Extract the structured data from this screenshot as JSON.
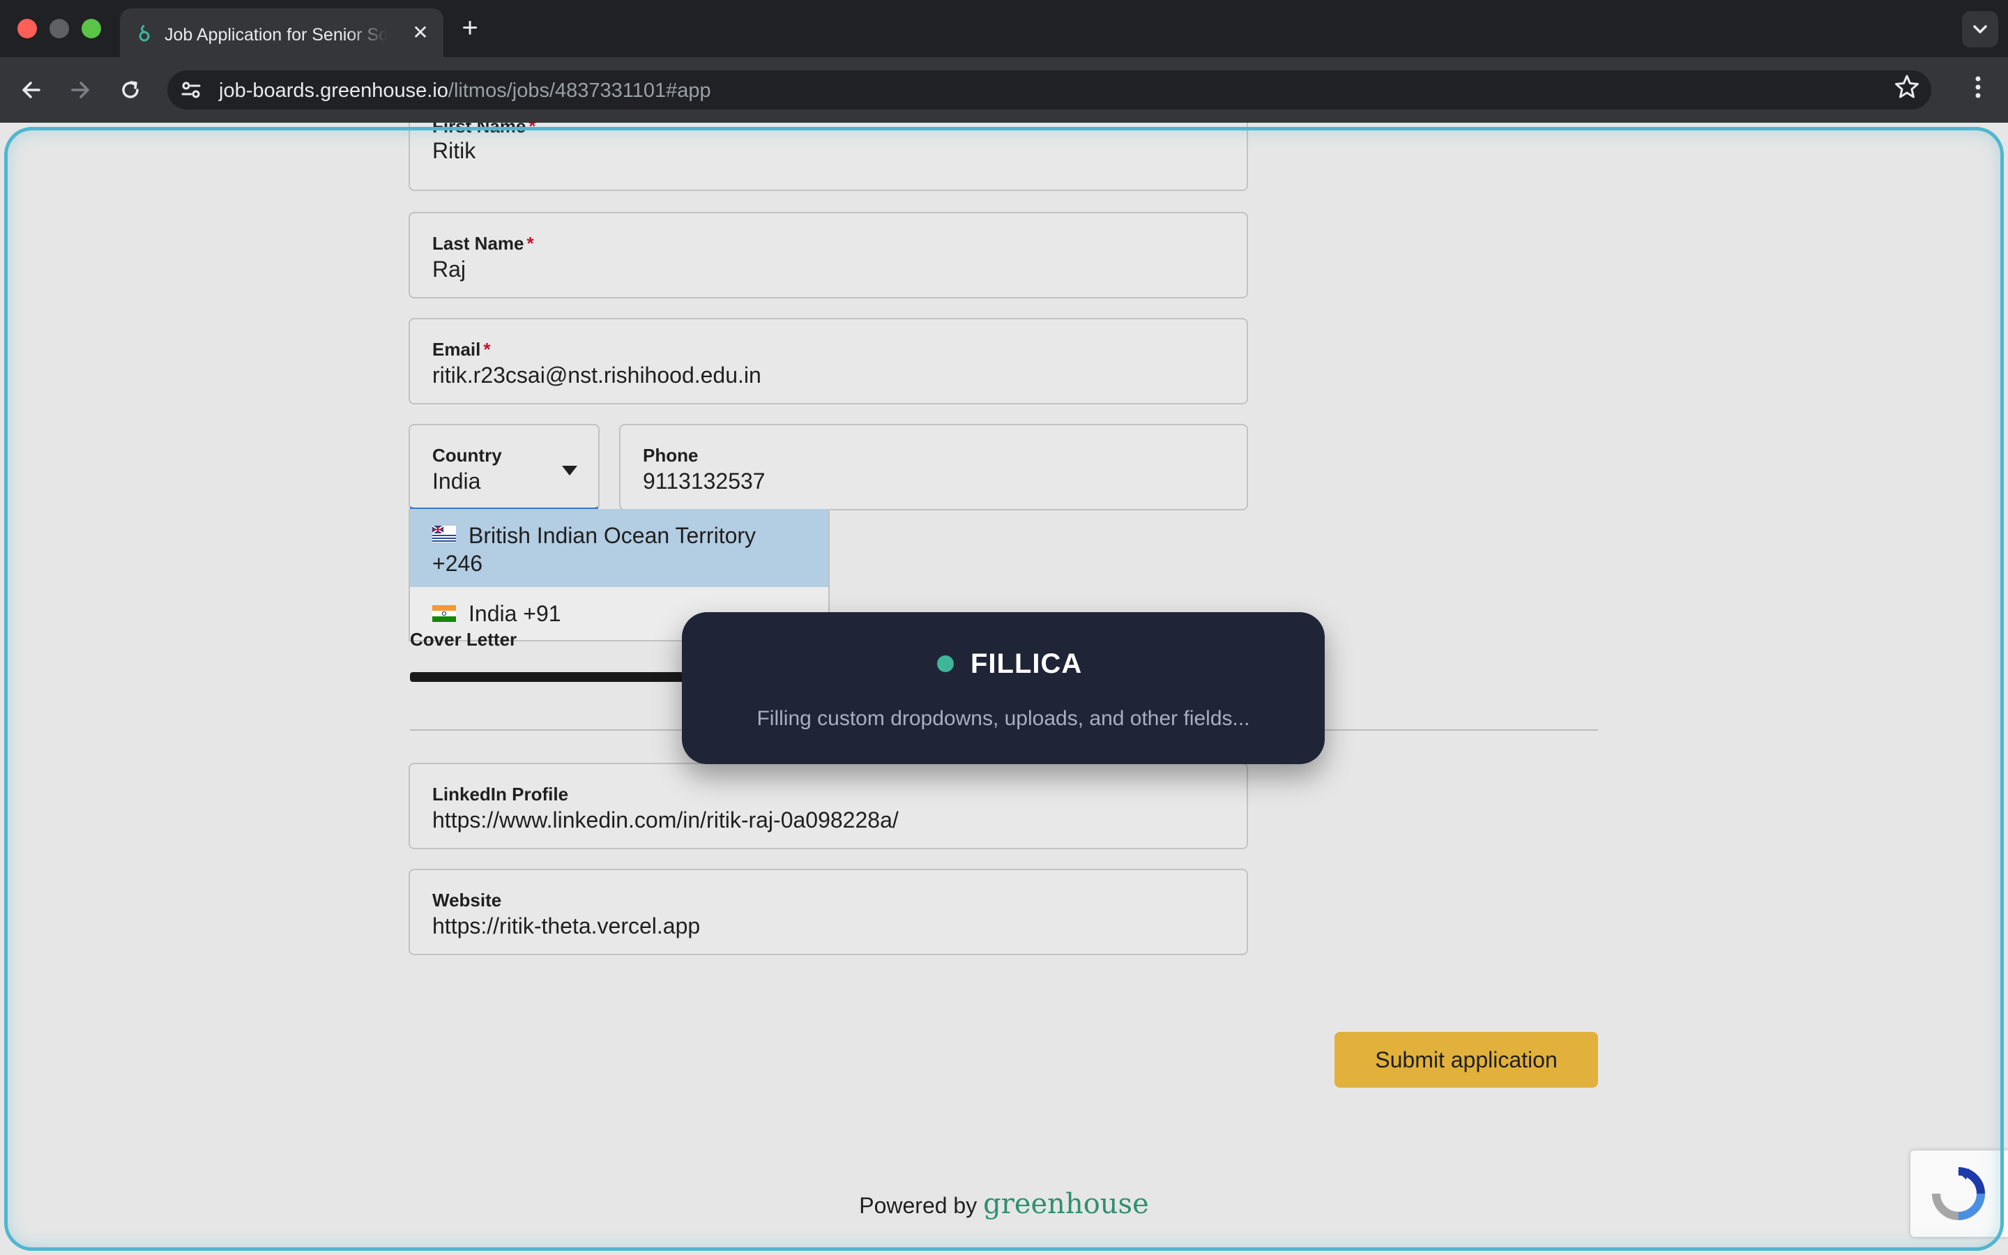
{
  "browser": {
    "tab_title": "Job Application for Senior Software Engineer",
    "tab_icon": "greenhouse-icon",
    "url_host": "job-boards.greenhouse.io",
    "url_path": "/litmos/jobs/4837331101#app"
  },
  "form": {
    "first_name": {
      "label": "First Name",
      "value": "Ritik"
    },
    "last_name": {
      "label": "Last Name",
      "value": "Raj"
    },
    "email": {
      "label": "Email",
      "value": "ritik.r23csai@nst.rishihood.edu.in"
    },
    "country": {
      "label": "Country",
      "value": "India"
    },
    "phone": {
      "label": "Phone",
      "value": "9113132537"
    },
    "required_marker": "*",
    "country_options": [
      {
        "line1": "British Indian Ocean Territory",
        "line2": "+246",
        "flag": "british-indian-ocean-territory-flag-icon",
        "highlighted": true
      },
      {
        "line1": "India +91",
        "flag": "india-flag-icon",
        "highlighted": false
      }
    ],
    "cover_letter": {
      "label": "Cover Letter"
    },
    "linkedin": {
      "label": "LinkedIn Profile",
      "value": "https://www.linkedin.com/in/ritik-raj-0a098228a/"
    },
    "website": {
      "label": "Website",
      "value": "https://ritik-theta.vercel.app"
    },
    "submit_label": "Submit application"
  },
  "overlay": {
    "title": "FILLICA",
    "message": "Filling custom dropdowns, uploads, and other fields...",
    "status_color": "#3fb59a"
  },
  "footer": {
    "powered_by": "Powered by",
    "brand": "greenhouse"
  },
  "colors": {
    "accent_border": "#4fb6cf",
    "submit": "#e2b13c",
    "required": "#c8102e",
    "brand": "#2f8f70"
  }
}
